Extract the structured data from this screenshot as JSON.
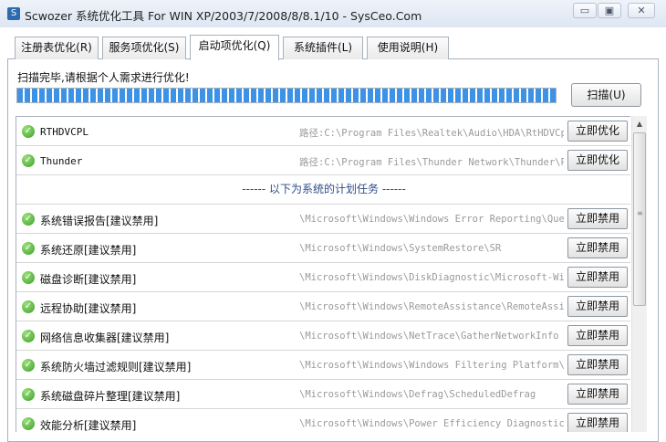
{
  "window": {
    "title": "Scwozer 系统优化工具 For WIN XP/2003/7/2008/8/8.1/10 - SysCeo.Com",
    "app_icon": "app-icon",
    "controls": {
      "minimize": "▭",
      "restore": "▣",
      "close": "✕"
    }
  },
  "tabs": [
    {
      "label": "注册表优化(R)"
    },
    {
      "label": "服务项优化(S)"
    },
    {
      "label": "启动项优化(Q)"
    },
    {
      "label": "系统插件(L)"
    },
    {
      "label": "使用说明(H)"
    }
  ],
  "active_tab": "启动项优化(Q)",
  "scan": {
    "status": "扫描完毕,请根据个人需求进行优化!",
    "button": "扫描(U)",
    "progress": 1.0
  },
  "startup_items": [
    {
      "name": "RTHDVCPL",
      "path": "路径:C:\\Program Files\\Realtek\\Audio\\HDA\\RtHDVCpl.e",
      "action": "立即优化"
    },
    {
      "name": "Thunder",
      "path": "路径:C:\\Program Files\\Thunder Network\\Thunder\\Prog",
      "action": "立即优化"
    }
  ],
  "separator": "------ 以下为系统的计划任务 ------",
  "scheduled_tasks": [
    {
      "name": "系统错误报告[建议禁用]",
      "path": "\\Microsoft\\Windows\\Windows Error Reporting\\QueueRe",
      "action": "立即禁用"
    },
    {
      "name": "系统还原[建议禁用]",
      "path": "\\Microsoft\\Windows\\SystemRestore\\SR",
      "action": "立即禁用"
    },
    {
      "name": "磁盘诊断[建议禁用]",
      "path": "\\Microsoft\\Windows\\DiskDiagnostic\\Microsoft-Window",
      "action": "立即禁用"
    },
    {
      "name": "远程协助[建议禁用]",
      "path": "\\Microsoft\\Windows\\RemoteAssistance\\RemoteAssistan",
      "action": "立即禁用"
    },
    {
      "name": "网络信息收集器[建议禁用]",
      "path": "\\Microsoft\\Windows\\NetTrace\\GatherNetworkInfo",
      "action": "立即禁用"
    },
    {
      "name": "系统防火墙过滤规则[建议禁用]",
      "path": "\\Microsoft\\Windows\\Windows Filtering Platform\\BfeO",
      "action": "立即禁用"
    },
    {
      "name": "系统磁盘碎片整理[建议禁用]",
      "path": "\\Microsoft\\Windows\\Defrag\\ScheduledDefrag",
      "action": "立即禁用"
    },
    {
      "name": "效能分析[建议禁用]",
      "path": "\\Microsoft\\Windows\\Power Efficiency Diagnostics\\An",
      "action": "立即禁用"
    }
  ],
  "icons": {
    "row_status": "green-check-icon",
    "scroll_up": "scroll-up-arrow-icon"
  }
}
